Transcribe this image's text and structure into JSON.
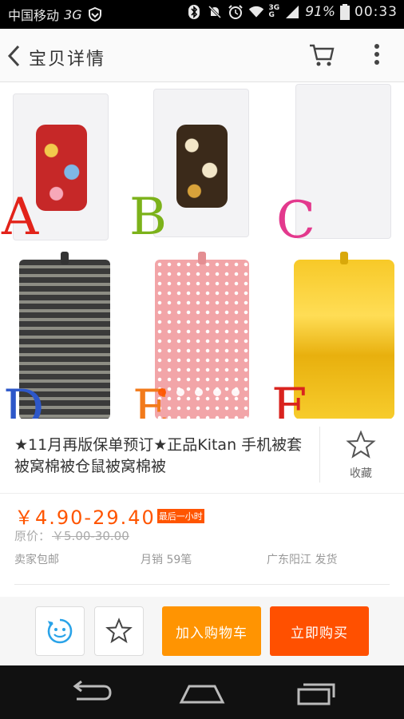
{
  "status_bar": {
    "carrier": "中国移动",
    "network_left": "3G",
    "network_right_top": "3G",
    "network_right_bottom": "G",
    "battery_percent": "91%",
    "time": "00:33",
    "icons": [
      "shield-icon",
      "bluetooth-icon",
      "mute-icon",
      "alarm-icon",
      "wifi-icon",
      "signal-icon",
      "battery-icon"
    ]
  },
  "header": {
    "title": "宝贝详情",
    "icons": [
      "back-chevron-icon",
      "cart-icon",
      "more-vertical-icon"
    ]
  },
  "gallery": {
    "option_letters": [
      "A",
      "B",
      "C",
      "D",
      "E",
      "F"
    ],
    "letter_colors": [
      "#e2231a",
      "#7cb21a",
      "#e3398d",
      "#2d57c9",
      "#f27a1a",
      "#d9231e"
    ],
    "image_count": 5,
    "active_index": 0
  },
  "product": {
    "title": "★11月再版保单预订★正品Kitan 手机被套被窝棉被仓鼠被窝棉被",
    "favorite_label": "收藏",
    "price": "￥4.90-29.40",
    "promo_badge": "最后一小时",
    "original_price_label": "原价：",
    "original_price": "￥5.00-30.00",
    "shipping": "卖家包邮",
    "monthly_sales": "月销 59笔",
    "ship_from": "广东阳江 发货"
  },
  "actions": {
    "chat_icon": "chat-face-icon",
    "star_icon": "star-icon",
    "add_to_cart_label": "加入购物车",
    "buy_now_label": "立即购买"
  },
  "nav_bar": {
    "icons": [
      "back-nav-icon",
      "home-nav-icon",
      "recent-apps-icon"
    ]
  },
  "colors": {
    "accent": "#ff5500",
    "cart_button": "#ff9402",
    "buy_button": "#ff5000"
  }
}
